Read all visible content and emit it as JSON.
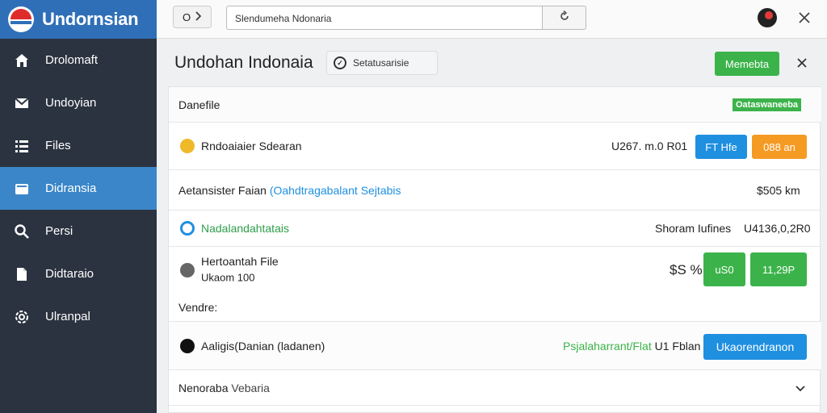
{
  "app": {
    "name": "Undornsian"
  },
  "sidebar": {
    "items": [
      {
        "label": "Drolomaft",
        "icon": "home-icon",
        "active": false
      },
      {
        "label": "Undoyian",
        "icon": "mail-icon",
        "active": false
      },
      {
        "label": "Files",
        "icon": "list-icon",
        "active": false
      },
      {
        "label": "Didransia",
        "icon": "folder-icon",
        "active": true
      },
      {
        "label": "Persi",
        "icon": "search-icon",
        "active": false
      },
      {
        "label": "Didtaraio",
        "icon": "document-icon",
        "active": false
      },
      {
        "label": "Ulranpal",
        "icon": "settings-icon",
        "active": false
      }
    ]
  },
  "topbar": {
    "nav_label": "O",
    "url": "Slendumeha Ndonaria",
    "user_icon": "user-avatar-icon"
  },
  "main": {
    "title": "Undohan Indonaia",
    "filter_label": "Setatusarisie",
    "primary_button": "Memebta"
  },
  "panel": {
    "header": {
      "label": "Danefile",
      "badge": "Oataswaneeba"
    },
    "row1": {
      "label": "Rndoaiaier Sdearan",
      "amount": "U267. m.0 R01",
      "btn_blue": "FT Hfe",
      "btn_orange": "088 an"
    },
    "row2": {
      "label": "Aetansister Faian",
      "link": "(Oahdtragabalant Sejtabis",
      "value": "$505 km"
    },
    "row3": {
      "label": "Nadalandahtatais",
      "info": "Shoram Iufines",
      "amount": "U4136,0,2R0"
    },
    "row4": {
      "label": "Hertoantah File",
      "sub": "Ukaom 100",
      "pct": "$S %",
      "btn1": "uS0",
      "btn2": "11,29P"
    },
    "vendor_label": "Vendre:",
    "row5": {
      "label": "Aaligis(Danian (ladanen)",
      "status": "Psjalaharrant/Flat",
      "status_suffix": "U1 Fblan",
      "btn": "Ukaorendranon"
    },
    "row6": {
      "label": "Nenoraba",
      "value": "Vebaria"
    }
  },
  "colors": {
    "sidebar_bg": "#2b3340",
    "brand_bg": "#2f6fb7",
    "active_bg": "#3b86c8",
    "green": "#3cb34a",
    "blue": "#1f8fe0",
    "orange": "#f59a23"
  }
}
